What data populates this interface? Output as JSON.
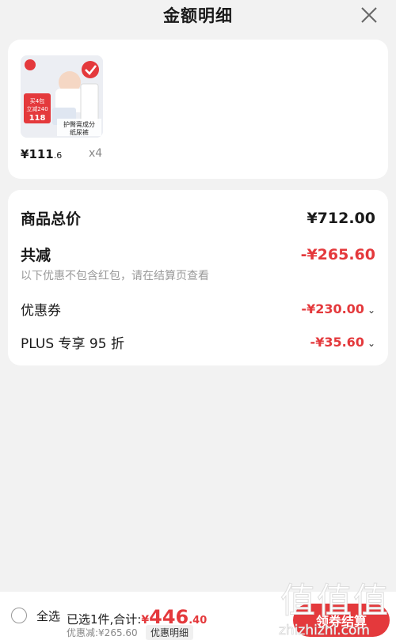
{
  "header": {
    "title": "金额明细"
  },
  "product": {
    "badge_text": [
      "买4包",
      "立减240",
      "118"
    ],
    "image_caption": [
      "护臀膏成分",
      "纸尿裤"
    ],
    "price_symbol": "¥",
    "price_int": "111",
    "price_dec": ".6",
    "qty": "x4"
  },
  "summary": {
    "total_label": "商品总价",
    "total_value": "¥712.00",
    "reduce_label": "共减",
    "reduce_value": "-¥265.60",
    "note": "以下优惠不包含红包，请在结算页查看",
    "coupon_label": "优惠券",
    "coupon_value": "-¥230.00",
    "plus_label": "PLUS 专享 95 折",
    "plus_value": "-¥35.60"
  },
  "footer": {
    "select_all": "全选",
    "selected_text": "已选1件,合计:",
    "total_symbol": "¥",
    "total_int": "446",
    "total_dec": ".40",
    "discount_text": "优惠减:¥265.60",
    "discount_tag": "优惠明细",
    "checkout": "领券结算"
  },
  "watermark": {
    "text": "值",
    "domain": "zhizhizhi.com"
  },
  "colors": {
    "accent": "#e4393c",
    "bg": "#f2f2f2"
  }
}
